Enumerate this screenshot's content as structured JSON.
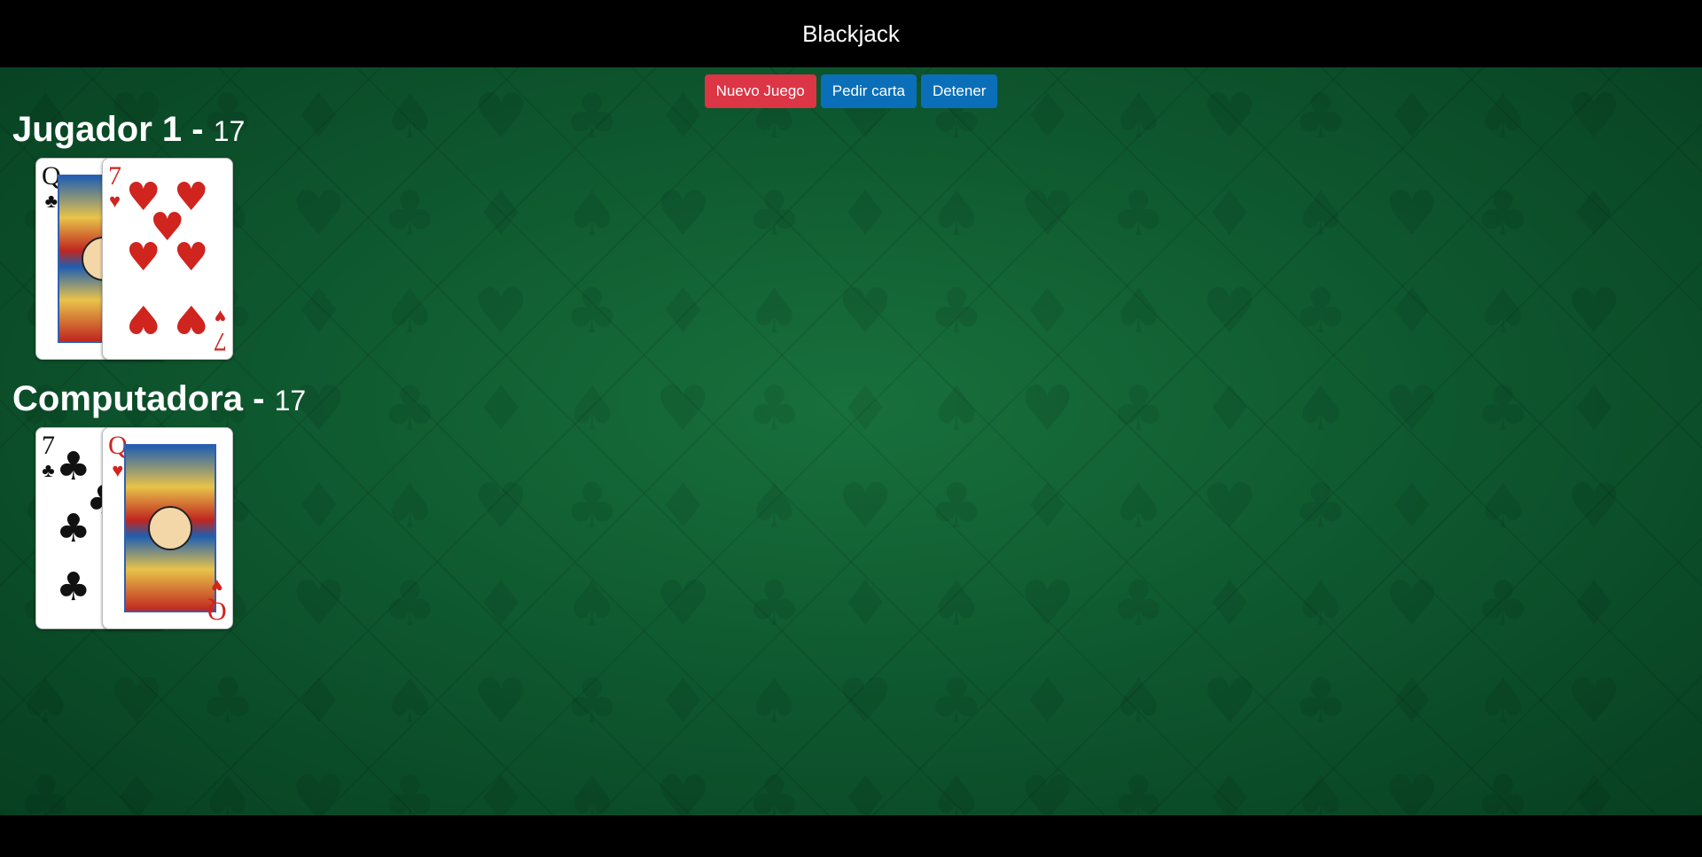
{
  "header": {
    "title": "Blackjack"
  },
  "controls": {
    "new_game": "Nuevo Juego",
    "hit": "Pedir carta",
    "stand": "Detener"
  },
  "colors": {
    "new_game_button": "#dc3545",
    "action_button": "#0a6fb8",
    "felt": "#0f5a30"
  },
  "player": {
    "name": "Jugador 1",
    "separator": "-",
    "score": "17",
    "cards": [
      {
        "rank": "Q",
        "suit": "♣",
        "color": "black"
      },
      {
        "rank": "7",
        "suit": "♥",
        "color": "red"
      }
    ]
  },
  "computer": {
    "name": "Computadora",
    "separator": "-",
    "score": "17",
    "cards": [
      {
        "rank": "7",
        "suit": "♣",
        "color": "black"
      },
      {
        "rank": "Q",
        "suit": "♥",
        "color": "red"
      }
    ]
  }
}
